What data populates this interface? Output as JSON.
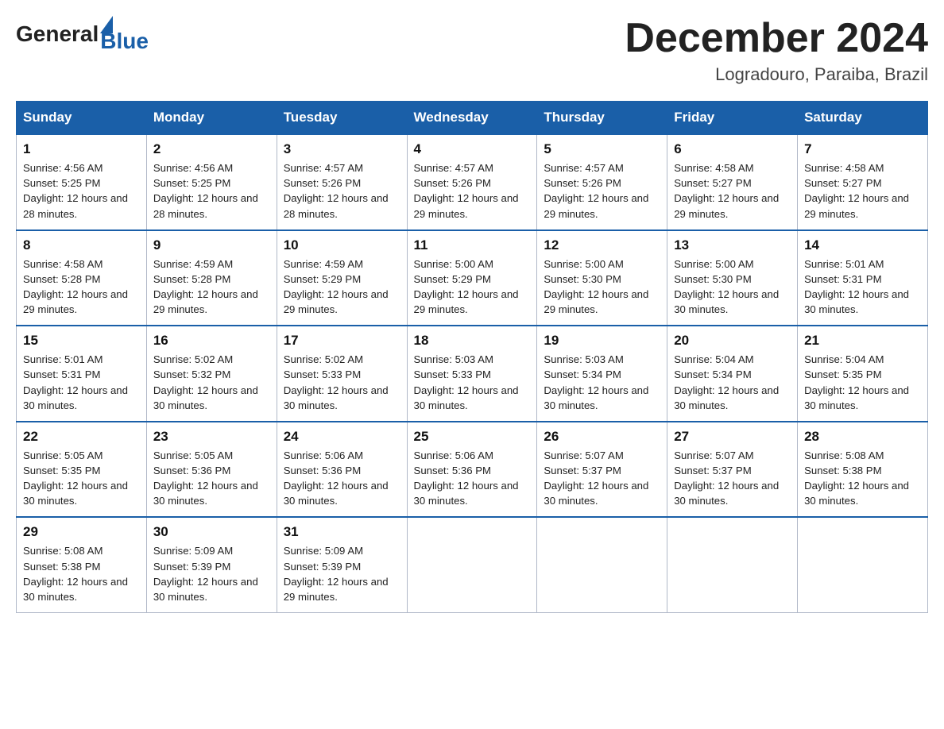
{
  "logo": {
    "general": "General",
    "blue": "Blue",
    "arrow": "▶"
  },
  "title": "December 2024",
  "location": "Logradouro, Paraiba, Brazil",
  "days_of_week": [
    "Sunday",
    "Monday",
    "Tuesday",
    "Wednesday",
    "Thursday",
    "Friday",
    "Saturday"
  ],
  "weeks": [
    [
      {
        "day": "1",
        "sunrise": "4:56 AM",
        "sunset": "5:25 PM",
        "daylight": "12 hours and 28 minutes."
      },
      {
        "day": "2",
        "sunrise": "4:56 AM",
        "sunset": "5:25 PM",
        "daylight": "12 hours and 28 minutes."
      },
      {
        "day": "3",
        "sunrise": "4:57 AM",
        "sunset": "5:26 PM",
        "daylight": "12 hours and 28 minutes."
      },
      {
        "day": "4",
        "sunrise": "4:57 AM",
        "sunset": "5:26 PM",
        "daylight": "12 hours and 29 minutes."
      },
      {
        "day": "5",
        "sunrise": "4:57 AM",
        "sunset": "5:26 PM",
        "daylight": "12 hours and 29 minutes."
      },
      {
        "day": "6",
        "sunrise": "4:58 AM",
        "sunset": "5:27 PM",
        "daylight": "12 hours and 29 minutes."
      },
      {
        "day": "7",
        "sunrise": "4:58 AM",
        "sunset": "5:27 PM",
        "daylight": "12 hours and 29 minutes."
      }
    ],
    [
      {
        "day": "8",
        "sunrise": "4:58 AM",
        "sunset": "5:28 PM",
        "daylight": "12 hours and 29 minutes."
      },
      {
        "day": "9",
        "sunrise": "4:59 AM",
        "sunset": "5:28 PM",
        "daylight": "12 hours and 29 minutes."
      },
      {
        "day": "10",
        "sunrise": "4:59 AM",
        "sunset": "5:29 PM",
        "daylight": "12 hours and 29 minutes."
      },
      {
        "day": "11",
        "sunrise": "5:00 AM",
        "sunset": "5:29 PM",
        "daylight": "12 hours and 29 minutes."
      },
      {
        "day": "12",
        "sunrise": "5:00 AM",
        "sunset": "5:30 PM",
        "daylight": "12 hours and 29 minutes."
      },
      {
        "day": "13",
        "sunrise": "5:00 AM",
        "sunset": "5:30 PM",
        "daylight": "12 hours and 30 minutes."
      },
      {
        "day": "14",
        "sunrise": "5:01 AM",
        "sunset": "5:31 PM",
        "daylight": "12 hours and 30 minutes."
      }
    ],
    [
      {
        "day": "15",
        "sunrise": "5:01 AM",
        "sunset": "5:31 PM",
        "daylight": "12 hours and 30 minutes."
      },
      {
        "day": "16",
        "sunrise": "5:02 AM",
        "sunset": "5:32 PM",
        "daylight": "12 hours and 30 minutes."
      },
      {
        "day": "17",
        "sunrise": "5:02 AM",
        "sunset": "5:33 PM",
        "daylight": "12 hours and 30 minutes."
      },
      {
        "day": "18",
        "sunrise": "5:03 AM",
        "sunset": "5:33 PM",
        "daylight": "12 hours and 30 minutes."
      },
      {
        "day": "19",
        "sunrise": "5:03 AM",
        "sunset": "5:34 PM",
        "daylight": "12 hours and 30 minutes."
      },
      {
        "day": "20",
        "sunrise": "5:04 AM",
        "sunset": "5:34 PM",
        "daylight": "12 hours and 30 minutes."
      },
      {
        "day": "21",
        "sunrise": "5:04 AM",
        "sunset": "5:35 PM",
        "daylight": "12 hours and 30 minutes."
      }
    ],
    [
      {
        "day": "22",
        "sunrise": "5:05 AM",
        "sunset": "5:35 PM",
        "daylight": "12 hours and 30 minutes."
      },
      {
        "day": "23",
        "sunrise": "5:05 AM",
        "sunset": "5:36 PM",
        "daylight": "12 hours and 30 minutes."
      },
      {
        "day": "24",
        "sunrise": "5:06 AM",
        "sunset": "5:36 PM",
        "daylight": "12 hours and 30 minutes."
      },
      {
        "day": "25",
        "sunrise": "5:06 AM",
        "sunset": "5:36 PM",
        "daylight": "12 hours and 30 minutes."
      },
      {
        "day": "26",
        "sunrise": "5:07 AM",
        "sunset": "5:37 PM",
        "daylight": "12 hours and 30 minutes."
      },
      {
        "day": "27",
        "sunrise": "5:07 AM",
        "sunset": "5:37 PM",
        "daylight": "12 hours and 30 minutes."
      },
      {
        "day": "28",
        "sunrise": "5:08 AM",
        "sunset": "5:38 PM",
        "daylight": "12 hours and 30 minutes."
      }
    ],
    [
      {
        "day": "29",
        "sunrise": "5:08 AM",
        "sunset": "5:38 PM",
        "daylight": "12 hours and 30 minutes."
      },
      {
        "day": "30",
        "sunrise": "5:09 AM",
        "sunset": "5:39 PM",
        "daylight": "12 hours and 30 minutes."
      },
      {
        "day": "31",
        "sunrise": "5:09 AM",
        "sunset": "5:39 PM",
        "daylight": "12 hours and 29 minutes."
      },
      null,
      null,
      null,
      null
    ]
  ]
}
